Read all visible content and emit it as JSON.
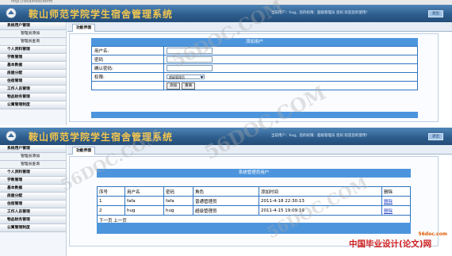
{
  "app": {
    "title": "鞍山师范学院学生宿舍管理系统",
    "user_info": "当前用户：hug，您的权限：超级管理员  您好,欢迎您的使用！",
    "exit_label": "退出"
  },
  "sidebar": {
    "items": [
      {
        "label": "系统用户管理",
        "type": "group"
      },
      {
        "label": "管理员添加",
        "type": "sub"
      },
      {
        "label": "管理员查询",
        "type": "sub"
      },
      {
        "label": "个人资料管理",
        "type": "group"
      },
      {
        "label": "学教管理",
        "type": "group"
      },
      {
        "label": "基本数据",
        "type": "group"
      },
      {
        "label": "房屋分配",
        "type": "group"
      },
      {
        "label": "住宿管理",
        "type": "group"
      },
      {
        "label": "工作人员管理",
        "type": "group"
      },
      {
        "label": "物品财务管理",
        "type": "group"
      },
      {
        "label": "公寓管理制度",
        "type": "group"
      }
    ]
  },
  "tab_label": "功能界面",
  "form": {
    "caption": "添加用户",
    "username_label": "用户名:",
    "password_label": "密码",
    "confirm_label": "确认密码:",
    "role_label": "权限:",
    "role_value": "超级管理员",
    "add_button": "添加",
    "reset_button": "重填"
  },
  "list": {
    "caption": "系统管理员用户",
    "columns": [
      "序号",
      "用户名",
      "密码",
      "角色",
      "添加时间",
      "删除"
    ],
    "rows": [
      {
        "no": "1",
        "username": "fafa",
        "password": "fafa",
        "role": "普通管理员",
        "time": "2011-4-18 22:30:13",
        "action": "删除"
      },
      {
        "no": "2",
        "username": "hug",
        "password": "hug",
        "role": "超级管理员",
        "time": "2011-4-15 19:09:19",
        "action": "删除"
      }
    ],
    "pager": "下一页  上一页"
  },
  "watermarks": [
    "56DOC.COM",
    "56DOC.COM",
    "56DOC.COM",
    "56DOC.COM"
  ],
  "brand": {
    "site": "56doc.com",
    "name": "中国毕业设计(论文)网"
  },
  "colors": {
    "header": "#2e5e8e",
    "title_text": "#f4c64e",
    "table_border": "#2f74c0",
    "caption_bg": "#4c95dd"
  }
}
